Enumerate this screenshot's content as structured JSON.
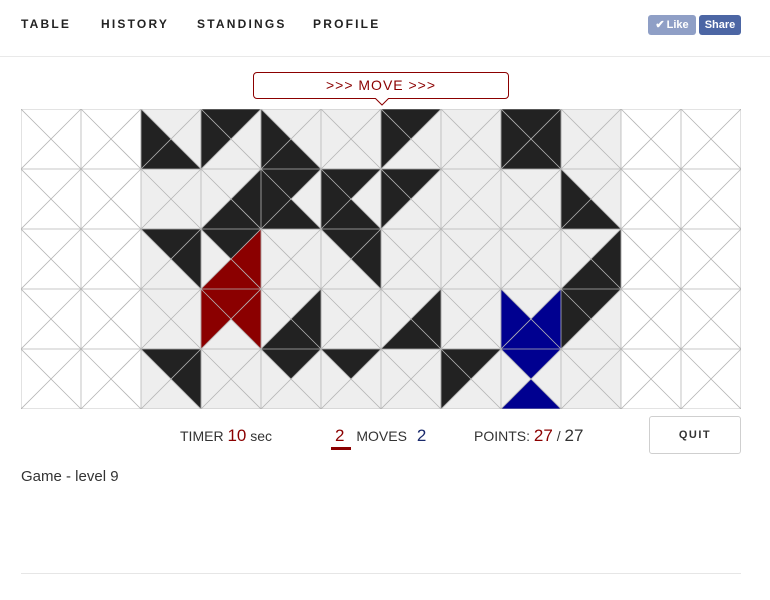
{
  "nav": {
    "items": [
      "TABLE",
      "HISTORY",
      "STANDINGS",
      "PROFILE"
    ]
  },
  "social": {
    "like_label": "Like",
    "share_label": "Share"
  },
  "banner": {
    "text": ">>> MOVE >>>"
  },
  "board": {
    "cols": 12,
    "rows": 5,
    "active_col_range": [
      2,
      9
    ],
    "colors": {
      "active_bg": "#eeeeee",
      "inactive_bg": "#ffffff",
      "grid_line": "#b5b5b5",
      "black": "#222222",
      "red": "#8b0000",
      "blue": "#000090"
    },
    "pieces": [
      {
        "color": "black",
        "triangles": [
          [
            2,
            0,
            "L"
          ],
          [
            2,
            0,
            "B"
          ],
          [
            3,
            0,
            "T"
          ],
          [
            3,
            0,
            "L"
          ],
          [
            4,
            0,
            "L"
          ],
          [
            4,
            0,
            "B"
          ],
          [
            6,
            0,
            "T"
          ],
          [
            6,
            0,
            "L"
          ],
          [
            8,
            0,
            "T"
          ],
          [
            8,
            0,
            "L"
          ],
          [
            8,
            0,
            "R"
          ],
          [
            8,
            0,
            "B"
          ]
        ]
      },
      {
        "color": "black",
        "triangles": [
          [
            3,
            1,
            "R"
          ],
          [
            3,
            1,
            "B"
          ],
          [
            4,
            1,
            "T"
          ],
          [
            4,
            1,
            "L"
          ],
          [
            4,
            1,
            "B"
          ],
          [
            3,
            2,
            "T"
          ],
          [
            5,
            1,
            "T"
          ],
          [
            5,
            1,
            "L"
          ],
          [
            5,
            1,
            "B"
          ],
          [
            6,
            1,
            "T"
          ],
          [
            6,
            1,
            "L"
          ],
          [
            9,
            1,
            "L"
          ],
          [
            9,
            1,
            "B"
          ]
        ]
      },
      {
        "color": "black",
        "triangles": [
          [
            2,
            2,
            "T"
          ],
          [
            2,
            2,
            "R"
          ],
          [
            5,
            2,
            "T"
          ],
          [
            5,
            2,
            "R"
          ],
          [
            9,
            2,
            "R"
          ],
          [
            9,
            2,
            "B"
          ],
          [
            9,
            3,
            "T"
          ],
          [
            9,
            3,
            "L"
          ],
          [
            6,
            3,
            "R"
          ],
          [
            6,
            3,
            "B"
          ],
          [
            4,
            3,
            "R"
          ],
          [
            4,
            3,
            "B"
          ],
          [
            4,
            4,
            "T"
          ],
          [
            2,
            4,
            "T"
          ],
          [
            2,
            4,
            "R"
          ],
          [
            7,
            4,
            "L"
          ],
          [
            7,
            4,
            "T"
          ],
          [
            5,
            4,
            "T"
          ]
        ]
      },
      {
        "color": "red",
        "triangles": [
          [
            3,
            2,
            "R"
          ],
          [
            3,
            2,
            "B"
          ],
          [
            3,
            3,
            "T"
          ],
          [
            3,
            3,
            "L"
          ],
          [
            3,
            3,
            "R"
          ]
        ]
      },
      {
        "color": "blue",
        "triangles": [
          [
            8,
            3,
            "L"
          ],
          [
            8,
            3,
            "R"
          ],
          [
            8,
            3,
            "B"
          ],
          [
            8,
            4,
            "T"
          ],
          [
            8,
            4,
            "B"
          ]
        ]
      }
    ]
  },
  "status": {
    "timer_label": "TIMER",
    "timer_value": "10",
    "timer_unit": "sec",
    "moves_left": "2",
    "moves_label": "MOVES",
    "moves_right": "2",
    "points_label": "POINTS:",
    "points_current": "27",
    "points_separator": "/",
    "points_total": "27"
  },
  "quit_label": "QUIT",
  "game_label": "Game - level 9"
}
